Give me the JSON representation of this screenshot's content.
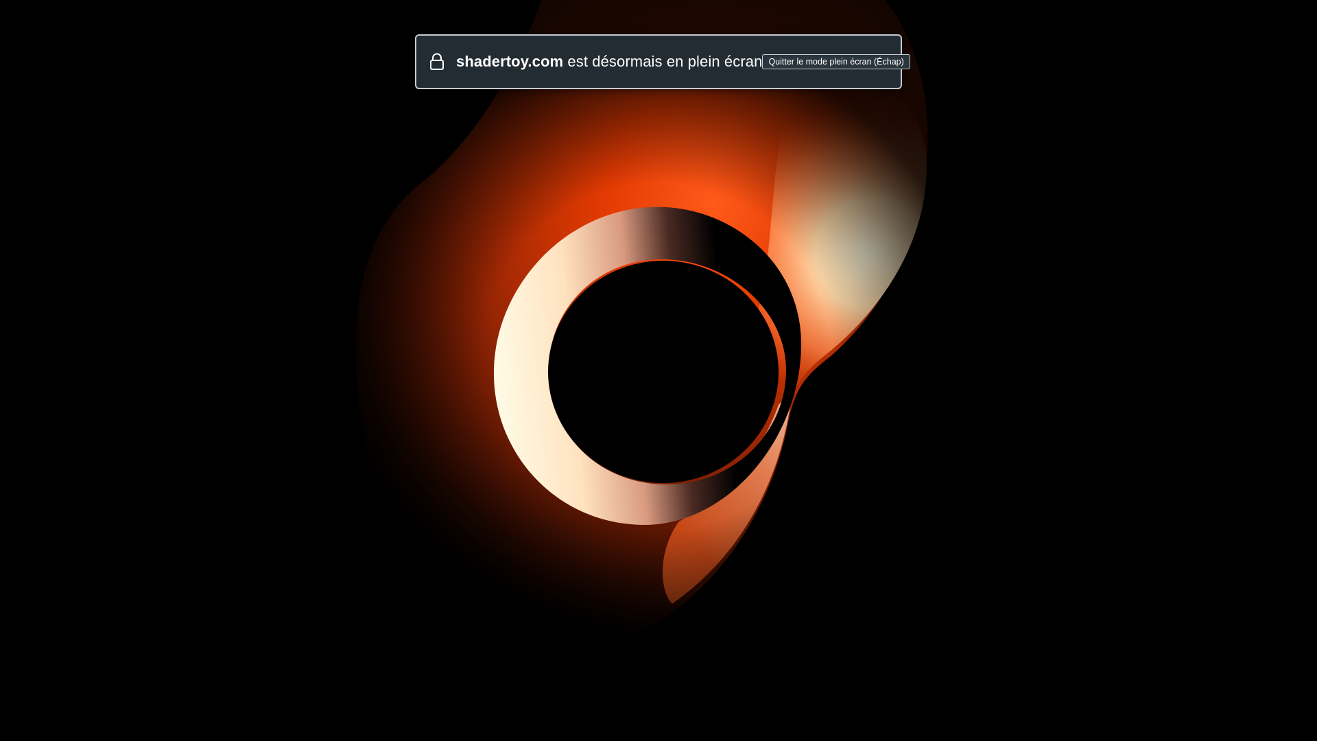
{
  "fullscreen_notice": {
    "domain": "shadertoy.com",
    "message": " est désormais en plein écran",
    "exit_button_label": "Quitter le mode plein écran (Échap)",
    "icon": "lock-icon"
  },
  "colors": {
    "background": "#000000",
    "notice_background": "#232c33",
    "notice_border": "#c5cbd1",
    "shader_orange": "#e63c00",
    "shader_cream": "#fff6dc"
  }
}
